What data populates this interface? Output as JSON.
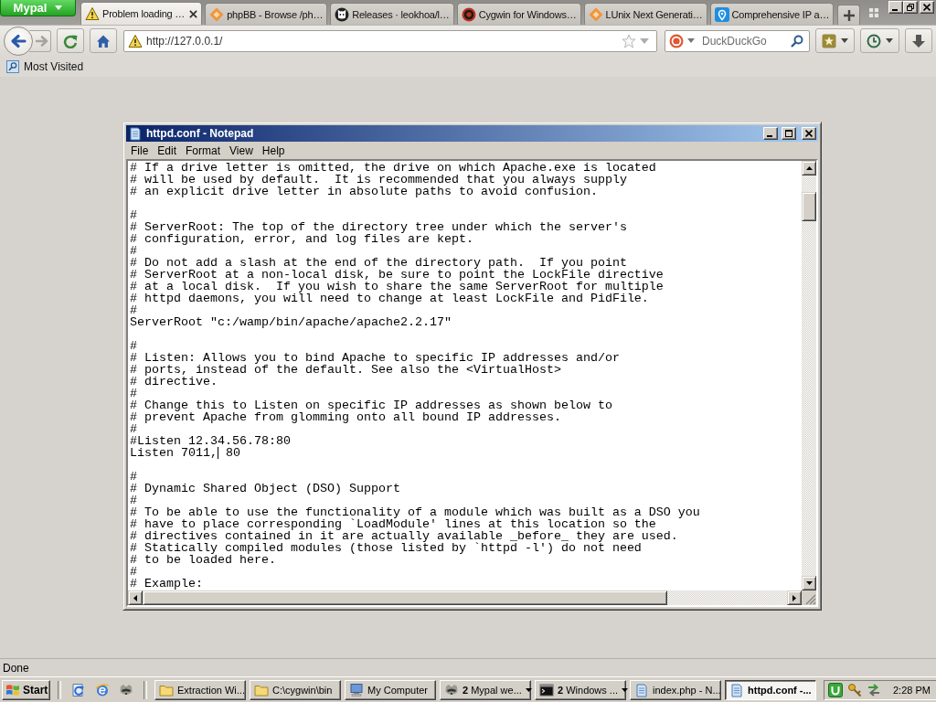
{
  "browser": {
    "app_menu": "Mypal",
    "tabs": [
      {
        "title": "Problem loading …",
        "kind": "warning",
        "selected": true
      },
      {
        "title": "phpBB - Browse /ph…",
        "kind": "diamond",
        "selected": false
      },
      {
        "title": "Releases · leokhoa/l…",
        "kind": "cat",
        "selected": false
      },
      {
        "title": "Cygwin for Windows…",
        "kind": "ring",
        "selected": false
      },
      {
        "title": "LUnix Next Generati…",
        "kind": "diamond",
        "selected": false
      },
      {
        "title": "Comprehensive IP a…",
        "kind": "pin",
        "selected": false
      }
    ]
  },
  "toolbar": {
    "forward_disabled": true,
    "address": "http://127.0.0.1/",
    "search_placeholder": "DuckDuckGo"
  },
  "bookmarks_bar": [
    {
      "label": "Most Visited"
    }
  ],
  "notepad": {
    "title": "httpd.conf - Notepad",
    "menu": [
      "File",
      "Edit",
      "Format",
      "View",
      "Help"
    ],
    "text_before_caret": "# If a drive letter is omitted, the drive on which Apache.exe is located\n# will be used by default.  It is recommended that you always supply\n# an explicit drive letter in absolute paths to avoid confusion.\n\n#\n# ServerRoot: The top of the directory tree under which the server's\n# configuration, error, and log files are kept.\n#\n# Do not add a slash at the end of the directory path.  If you point\n# ServerRoot at a non-local disk, be sure to point the LockFile directive\n# at a local disk.  If you wish to share the same ServerRoot for multiple\n# httpd daemons, you will need to change at least LockFile and PidFile.\n#\nServerRoot \"c:/wamp/bin/apache/apache2.2.17\"\n\n#\n# Listen: Allows you to bind Apache to specific IP addresses and/or\n# ports, instead of the default. See also the <VirtualHost>\n# directive.\n#\n# Change this to Listen on specific IP addresses as shown below to\n# prevent Apache from glomming onto all bound IP addresses.\n#\n#Listen 12.34.56.78:80",
    "caret_line": {
      "before": "Listen 7011,",
      "after": " 80"
    },
    "text_after_caret": "\n#\n# Dynamic Shared Object (DSO) Support\n#\n# To be able to use the functionality of a module which was built as a DSO you\n# have to place corresponding `LoadModule' lines at this location so the\n# directives contained in it are actually available _before_ they are used.\n# Statically compiled modules (those listed by `httpd -l') do not need\n# to be loaded here.\n#\n# Example:"
  },
  "status_bar": "Done",
  "taskbar": {
    "start": "Start",
    "buttons": [
      {
        "label": "Extraction Wi...",
        "kind": "folder",
        "grouped": false,
        "selected": false
      },
      {
        "label": "C:\\cygwin\\bin",
        "kind": "folder",
        "grouped": false,
        "selected": false
      },
      {
        "label": "My Computer",
        "kind": "computer",
        "grouped": false,
        "selected": false
      },
      {
        "count": "2",
        "label": "Mypal we...",
        "kind": "animal",
        "grouped": true,
        "selected": false
      },
      {
        "count": "2",
        "label": "Windows ...",
        "kind": "console",
        "grouped": true,
        "selected": false
      },
      {
        "label": "index.php - N...",
        "kind": "notepad",
        "grouped": false,
        "selected": false
      },
      {
        "label": "httpd.conf -...",
        "kind": "notepad",
        "grouped": false,
        "selected": true
      }
    ],
    "clock": "2:28 PM"
  }
}
